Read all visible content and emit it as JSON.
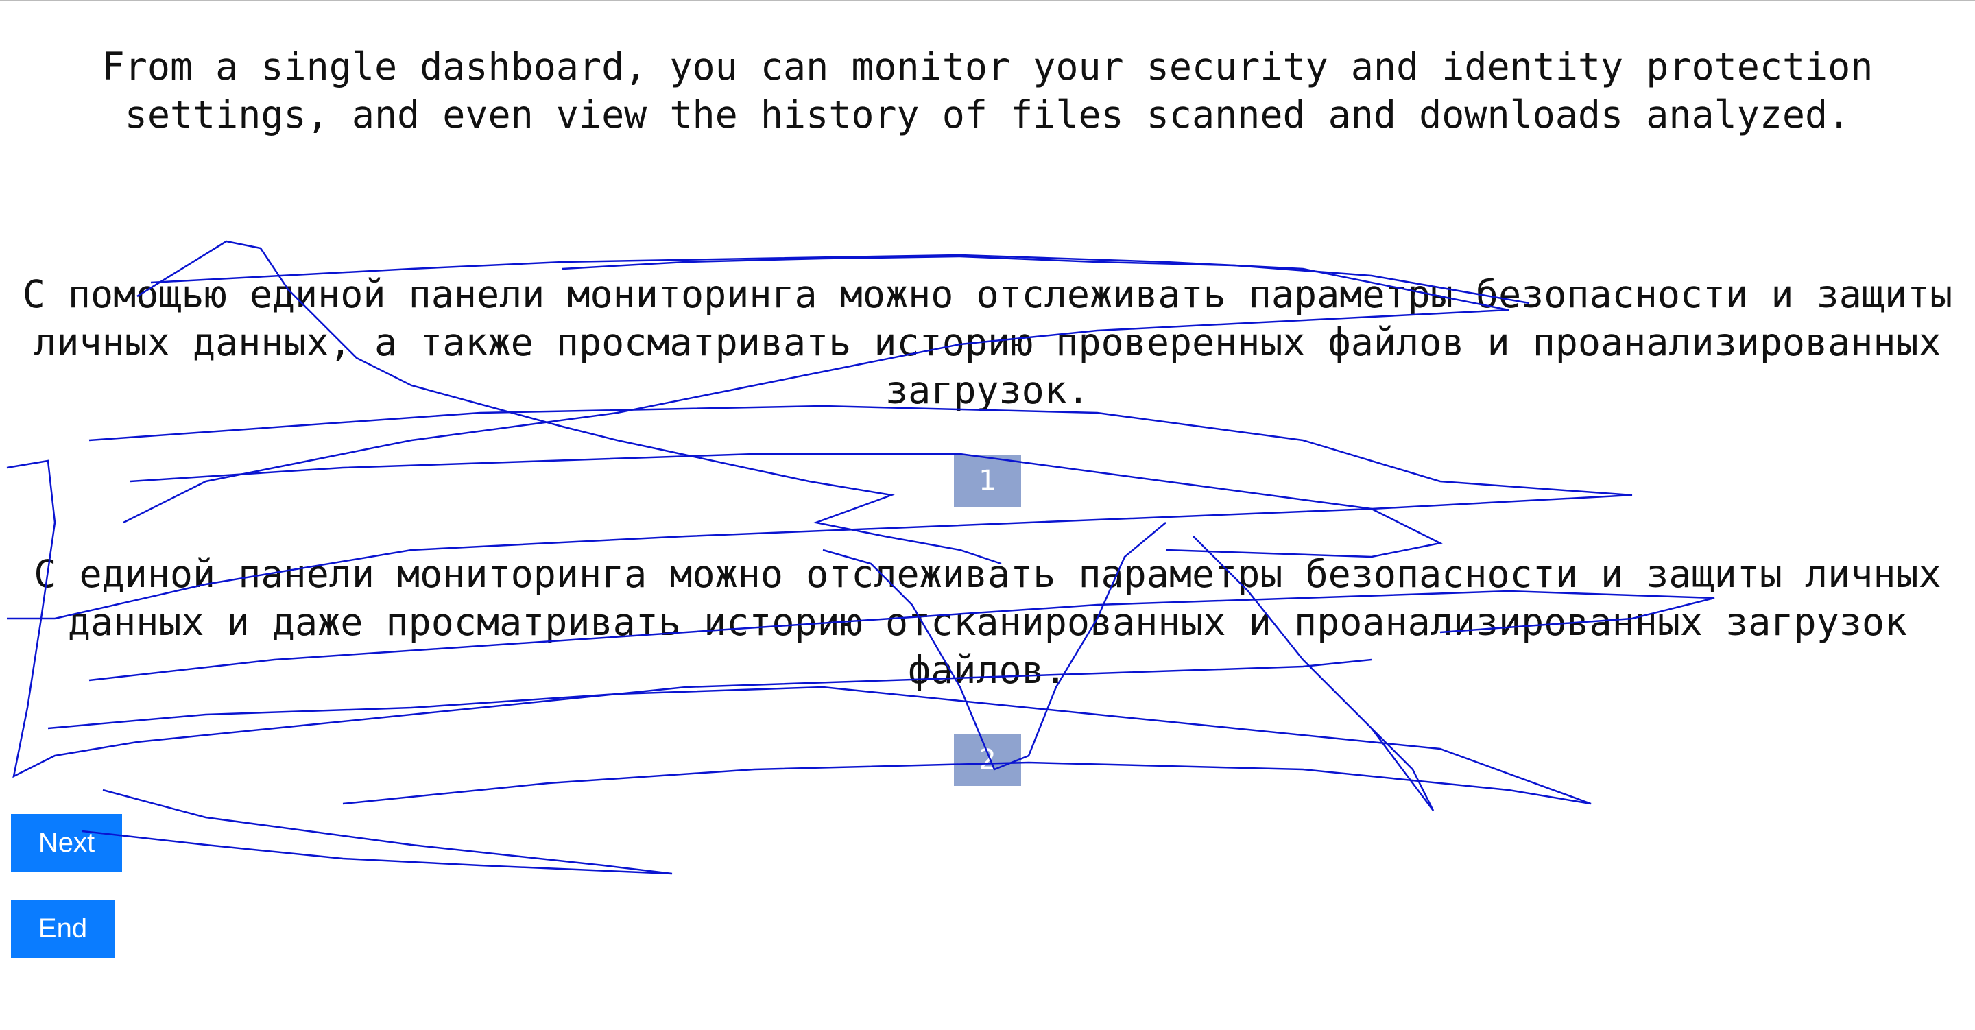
{
  "paragraphs": {
    "english": "From a single dashboard, you can monitor your security and identity protection settings, and even view the history of files scanned and downloads analyzed.",
    "russian_1": "С помощью единой панели мониторинга можно отслеживать параметры безопасности и защиты личных данных, а также просматривать историю проверенных файлов и проанализированных загрузок.",
    "russian_2": "С единой панели мониторинга можно отслеживать параметры безопасности и защиты личных данных и даже просматривать историю отсканированных и проанализированных загрузок файлов."
  },
  "options": {
    "option_1": "1",
    "option_2": "2"
  },
  "buttons": {
    "next": "Next",
    "end": "End"
  },
  "colors": {
    "button": "#0a7cff",
    "option": "#8fa3cf",
    "scribble": "#0a14d0"
  }
}
